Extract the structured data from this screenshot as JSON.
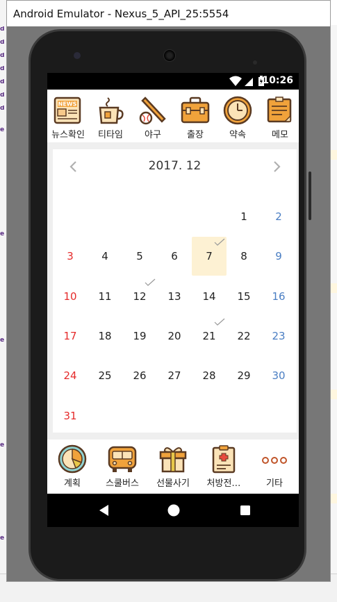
{
  "window": {
    "title": "Android Emulator - Nexus_5_API_25:5554"
  },
  "status_bar": {
    "time": "10:26"
  },
  "top_categories": [
    {
      "label": "뉴스확인",
      "icon": "newspaper-icon",
      "badge": "NEWS"
    },
    {
      "label": "티타임",
      "icon": "tea-cup-icon"
    },
    {
      "label": "야구",
      "icon": "baseball-icon"
    },
    {
      "label": "출장",
      "icon": "briefcase-icon"
    },
    {
      "label": "약속",
      "icon": "clock-icon"
    },
    {
      "label": "메모",
      "icon": "memo-icon"
    }
  ],
  "calendar": {
    "title": "2017. 12",
    "prev_icon": "chevron-left-icon",
    "next_icon": "chevron-right-icon",
    "selected_day": "7",
    "checked_days": [
      "7",
      "12",
      "21"
    ],
    "weeks": [
      [
        "",
        "",
        "",
        "",
        "",
        "1",
        "2"
      ],
      [
        "3",
        "4",
        "5",
        "6",
        "7",
        "8",
        "9"
      ],
      [
        "10",
        "11",
        "12",
        "13",
        "14",
        "15",
        "16"
      ],
      [
        "17",
        "18",
        "19",
        "20",
        "21",
        "22",
        "23"
      ],
      [
        "24",
        "25",
        "26",
        "27",
        "28",
        "29",
        "30"
      ],
      [
        "31",
        "",
        "",
        "",
        "",
        "",
        ""
      ]
    ],
    "colors": {
      "sunday": "#e52b2b",
      "saturday": "#4a7ec3",
      "selected_bg": "#fdf1d3"
    }
  },
  "bottom_categories": [
    {
      "label": "계획",
      "icon": "pie-chart-icon"
    },
    {
      "label": "스쿨버스",
      "icon": "school-bus-icon"
    },
    {
      "label": "선물사기",
      "icon": "gift-icon"
    },
    {
      "label": "처방전…",
      "icon": "prescription-icon"
    },
    {
      "label": "기타",
      "icon": "more-dots-icon"
    }
  ],
  "nav": {
    "back_icon": "back-triangle-icon",
    "home_icon": "home-circle-icon",
    "recents_icon": "recents-square-icon"
  },
  "background_labels": {
    "left_marks": [
      "d",
      "d",
      "d",
      "d",
      "d",
      "d",
      "d",
      "e",
      "e",
      "e",
      "e",
      "e"
    ]
  }
}
